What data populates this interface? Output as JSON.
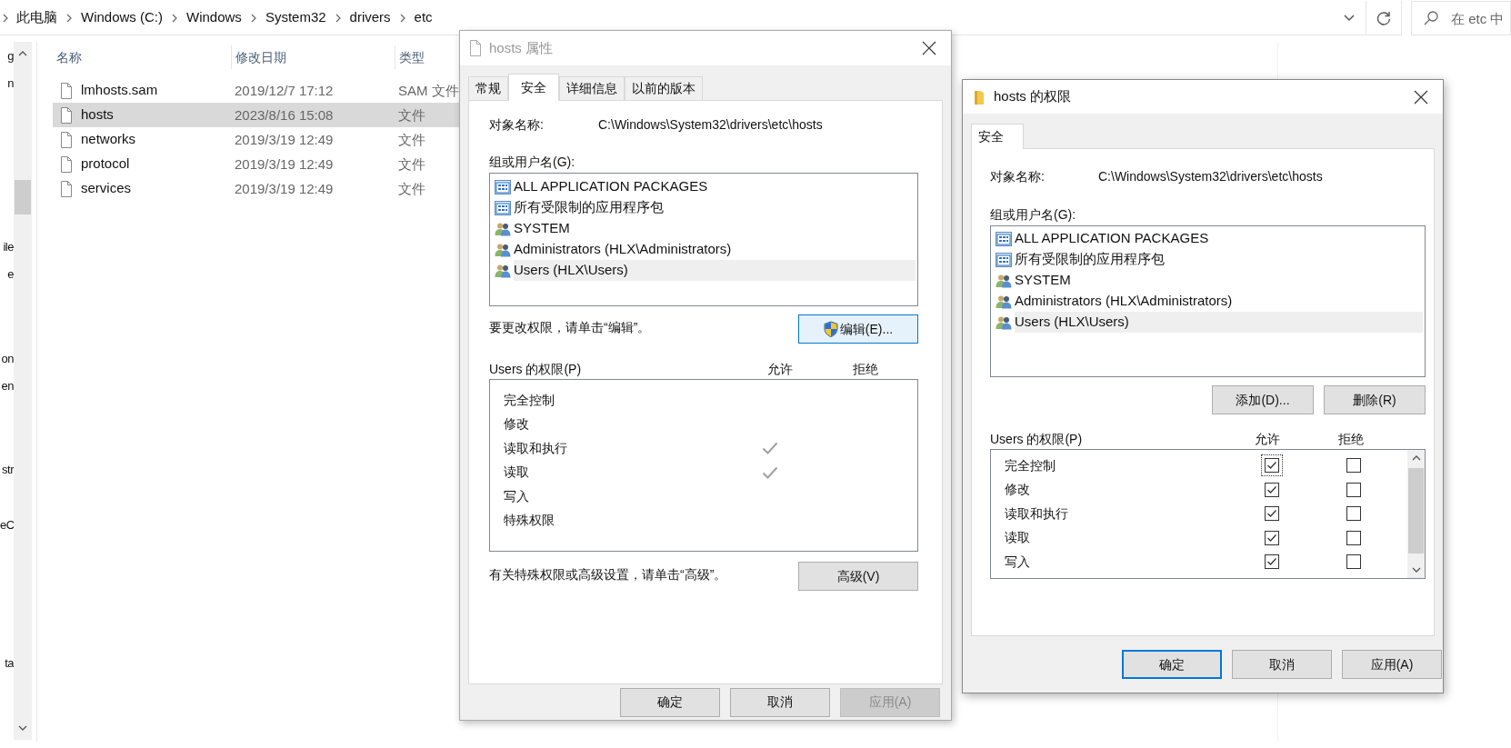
{
  "explorer": {
    "breadcrumb": [
      "此电脑",
      "Windows (C:)",
      "Windows",
      "System32",
      "drivers",
      "etc"
    ],
    "search": {
      "placeholder": "在 etc 中"
    },
    "nav_fragments": [
      "g",
      "n",
      "ile",
      "e",
      "on",
      "en",
      "str",
      "eC",
      "ta"
    ],
    "columns": [
      "名称",
      "修改日期",
      "类型"
    ],
    "files": [
      {
        "name": "lmhosts.sam",
        "modified": "2019/12/7 17:12",
        "type": "SAM 文件",
        "selected": false
      },
      {
        "name": "hosts",
        "modified": "2023/8/16 15:08",
        "type": "文件",
        "selected": true
      },
      {
        "name": "networks",
        "modified": "2019/3/19 12:49",
        "type": "文件",
        "selected": false
      },
      {
        "name": "protocol",
        "modified": "2019/3/19 12:49",
        "type": "文件",
        "selected": false
      },
      {
        "name": "services",
        "modified": "2019/3/19 12:49",
        "type": "文件",
        "selected": false
      }
    ]
  },
  "properties_dialog": {
    "title": "hosts 属性",
    "tabs": [
      {
        "label": "常规",
        "selected": false
      },
      {
        "label": "安全",
        "selected": true
      },
      {
        "label": "详细信息",
        "selected": false
      },
      {
        "label": "以前的版本",
        "selected": false
      }
    ],
    "object_label": "对象名称:",
    "object_path": "C:\\Windows\\System32\\drivers\\etc\\hosts",
    "groups_label": "组或用户名(G):",
    "principals": [
      {
        "name": "ALL APPLICATION PACKAGES",
        "kind": "package",
        "selected": false
      },
      {
        "name": "所有受限制的应用程序包",
        "kind": "package",
        "selected": false
      },
      {
        "name": "SYSTEM",
        "kind": "group",
        "selected": false
      },
      {
        "name": "Administrators (HLX\\Administrators)",
        "kind": "group",
        "selected": false
      },
      {
        "name": "Users (HLX\\Users)",
        "kind": "group",
        "selected": true
      }
    ],
    "edit_hint": "要更改权限，请单击“编辑”。",
    "edit_button": "编辑(E)...",
    "permissions_label": "Users 的权限(P)",
    "allow_header": "允许",
    "deny_header": "拒绝",
    "permissions": [
      {
        "name": "完全控制",
        "allow": false,
        "deny": false
      },
      {
        "name": "修改",
        "allow": false,
        "deny": false
      },
      {
        "name": "读取和执行",
        "allow": true,
        "deny": false
      },
      {
        "name": "读取",
        "allow": true,
        "deny": false
      },
      {
        "name": "写入",
        "allow": false,
        "deny": false
      },
      {
        "name": "特殊权限",
        "allow": false,
        "deny": false
      }
    ],
    "advanced_hint": "有关特殊权限或高级设置，请单击“高级”。",
    "advanced_button": "高级(V)",
    "buttons": [
      {
        "label": "确定",
        "disabled": false
      },
      {
        "label": "取消",
        "disabled": false
      },
      {
        "label": "应用(A)",
        "disabled": true
      }
    ]
  },
  "permissions_dialog": {
    "title": "hosts 的权限",
    "tabs": [
      {
        "label": "安全",
        "selected": true
      }
    ],
    "object_label": "对象名称:",
    "object_path": "C:\\Windows\\System32\\drivers\\etc\\hosts",
    "groups_label": "组或用户名(G):",
    "principals": [
      {
        "name": "ALL APPLICATION PACKAGES",
        "kind": "package",
        "selected": false
      },
      {
        "name": "所有受限制的应用程序包",
        "kind": "package",
        "selected": false
      },
      {
        "name": "SYSTEM",
        "kind": "group",
        "selected": false
      },
      {
        "name": "Administrators (HLX\\Administrators)",
        "kind": "group",
        "selected": false
      },
      {
        "name": "Users (HLX\\Users)",
        "kind": "group",
        "selected": true
      }
    ],
    "add_button": "添加(D)...",
    "remove_button": "删除(R)",
    "permissions_label": "Users 的权限(P)",
    "allow_header": "允许",
    "deny_header": "拒绝",
    "permissions": [
      {
        "name": "完全控制",
        "allow": true,
        "deny": false,
        "focused": true
      },
      {
        "name": "修改",
        "allow": true,
        "deny": false,
        "focused": false
      },
      {
        "name": "读取和执行",
        "allow": true,
        "deny": false,
        "focused": false
      },
      {
        "name": "读取",
        "allow": true,
        "deny": false,
        "focused": false
      },
      {
        "name": "写入",
        "allow": true,
        "deny": false,
        "focused": false
      }
    ],
    "buttons": [
      {
        "label": "确定",
        "default": true
      },
      {
        "label": "取消",
        "default": false
      },
      {
        "label": "应用(A)",
        "default": false
      }
    ]
  }
}
